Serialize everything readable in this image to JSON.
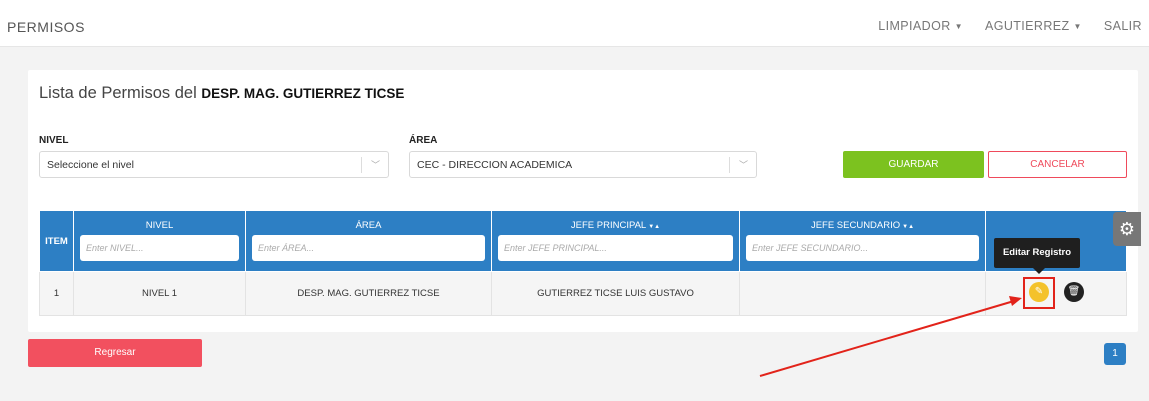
{
  "header": {
    "brand": "PERMISOS",
    "nav": [
      "LIMPIADOR",
      "AGUTIERREZ",
      "SALIR"
    ]
  },
  "card": {
    "title_prefix": "Lista de Permisos del ",
    "title_bold": "DESP. MAG. GUTIERREZ TICSE"
  },
  "form": {
    "nivel_label": "NIVEL",
    "nivel_value": "Seleccione el nivel",
    "area_label": "ÁREA",
    "area_value": "CEC - DIRECCION ACADEMICA",
    "save_label": "GUARDAR",
    "cancel_label": "CANCELAR"
  },
  "table": {
    "headers": [
      "ITEM",
      "NIVEL",
      "ÁREA",
      "JEFE PRINCIPAL",
      "JEFE SECUNDARIO"
    ],
    "placeholders": [
      "Enter NIVEL...",
      "Enter ÁREA...",
      "Enter JEFE PRINCIPAL...",
      "Enter JEFE SECUNDARIO..."
    ],
    "rows": [
      {
        "item": "1",
        "nivel": "NIVEL 1",
        "area": "DESP. MAG. GUTIERREZ TICSE",
        "jefe_principal": "GUTIERREZ TICSE LUIS GUSTAVO",
        "jefe_secundario": ""
      }
    ]
  },
  "tooltip": "Editar Registro",
  "footer": {
    "back_label": "Regresar",
    "page": "1"
  },
  "colors": {
    "primary": "#2d7fc4",
    "save": "#7cc21f",
    "danger": "#ef4a5b",
    "edit": "#f4c22b",
    "annotation": "#e2231a"
  },
  "icons": {
    "settings": "gear-icon",
    "edit": "edit-icon",
    "delete": "trash-icon",
    "dropdown": "chevron-down-icon"
  }
}
